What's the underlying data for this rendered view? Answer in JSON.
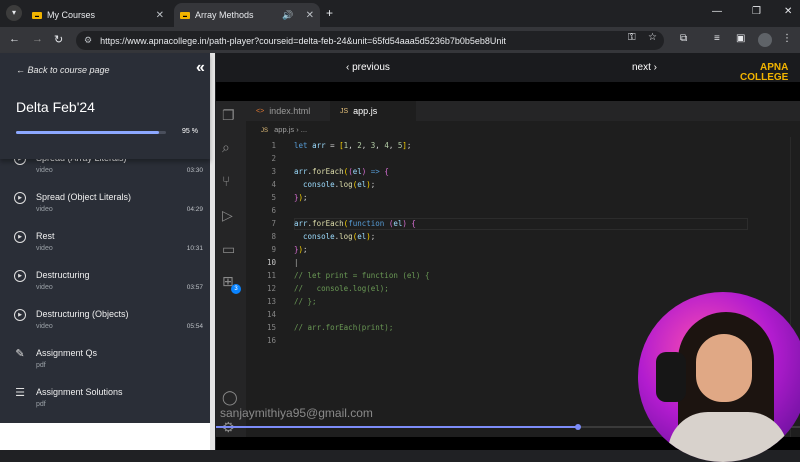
{
  "browser": {
    "tabs": [
      {
        "label": "My Courses",
        "favicon": "apna",
        "active": false
      },
      {
        "label": "Array Methods",
        "favicon": "apna",
        "active": true
      }
    ],
    "url": "https://www.apnacollege.in/path-player?courseid=delta-feb-24&unit=65fd54aaa5d5236b7b0b5eb8Unit"
  },
  "sidebar": {
    "back_label": "← Back to course page",
    "course_title": "Delta Feb'24",
    "progress_percent": 95,
    "progress_label": "95 %",
    "items": [
      {
        "title": "Spread (Array Literals)",
        "subtitle": "video",
        "duration": "03:30",
        "icon": "play-circle-icon"
      },
      {
        "title": "Spread (Object Literals)",
        "subtitle": "video",
        "duration": "04:29",
        "icon": "play-circle-icon"
      },
      {
        "title": "Rest",
        "subtitle": "video",
        "duration": "10:31",
        "icon": "play-circle-icon"
      },
      {
        "title": "Destructuring",
        "subtitle": "video",
        "duration": "03:57",
        "icon": "play-circle-icon"
      },
      {
        "title": "Destructuring (Objects)",
        "subtitle": "video",
        "duration": "05:54",
        "icon": "play-circle-icon"
      },
      {
        "title": "Assignment Qs",
        "subtitle": "pdf",
        "duration": "",
        "icon": "assignment-icon"
      },
      {
        "title": "Assignment Solutions",
        "subtitle": "pdf",
        "duration": "",
        "icon": "checklist-icon"
      }
    ]
  },
  "player": {
    "prev_label": "‹ previous",
    "next_label": "next ›",
    "watermark": "sanjaymithiya95@gmail.com",
    "logo_line1": "APNA",
    "logo_line2": "COLLEGE",
    "seek_percent": 62,
    "editor": {
      "tabs": [
        {
          "label": "index.html",
          "icon": "<>"
        },
        {
          "label": "app.js",
          "icon": "JS"
        }
      ],
      "breadcrumb_file": "app.js",
      "breadcrumb_tail": "› ...",
      "scm_badge": "3",
      "line_numbers": [
        "1",
        "2",
        "3",
        "4",
        "5",
        "6",
        "7",
        "8",
        "9",
        "10",
        "11",
        "12",
        "13",
        "14",
        "15",
        "16"
      ]
    }
  },
  "colors": {
    "accent": "#7c8cf8",
    "sidebar_bg": "#2a2e37",
    "editor_bg": "#1e1e1e"
  }
}
